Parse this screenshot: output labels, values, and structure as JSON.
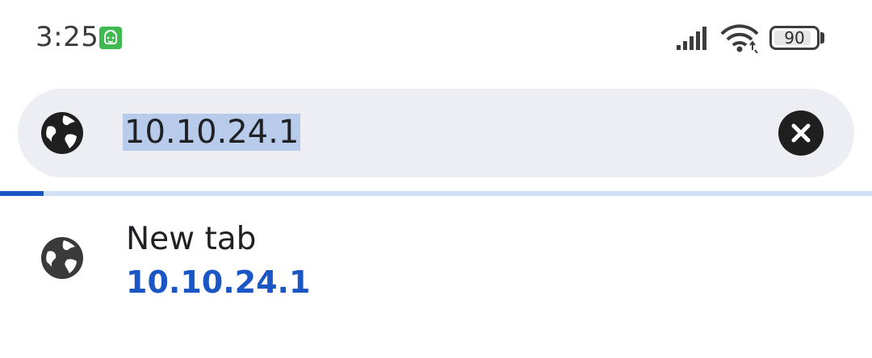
{
  "status_bar": {
    "time": "3:25",
    "notification_icon": "android-robot-icon",
    "signal_icon": "cell-signal-icon",
    "wifi_icon": "wifi-icon",
    "battery_level": "90",
    "battery_fraction": 0.9
  },
  "omnibox": {
    "leading_icon": "globe-icon",
    "value": "10.10.24.1",
    "clear_icon": "close-icon"
  },
  "load_progress": 0.05,
  "suggestions": [
    {
      "icon": "globe-icon",
      "title": "New tab",
      "url": "10.10.24.1"
    }
  ],
  "colors": {
    "accent": "#1a56c4",
    "omnibox_bg": "#eceef3",
    "selection": "#b9cbea",
    "progress_track": "#cfe0f6"
  }
}
